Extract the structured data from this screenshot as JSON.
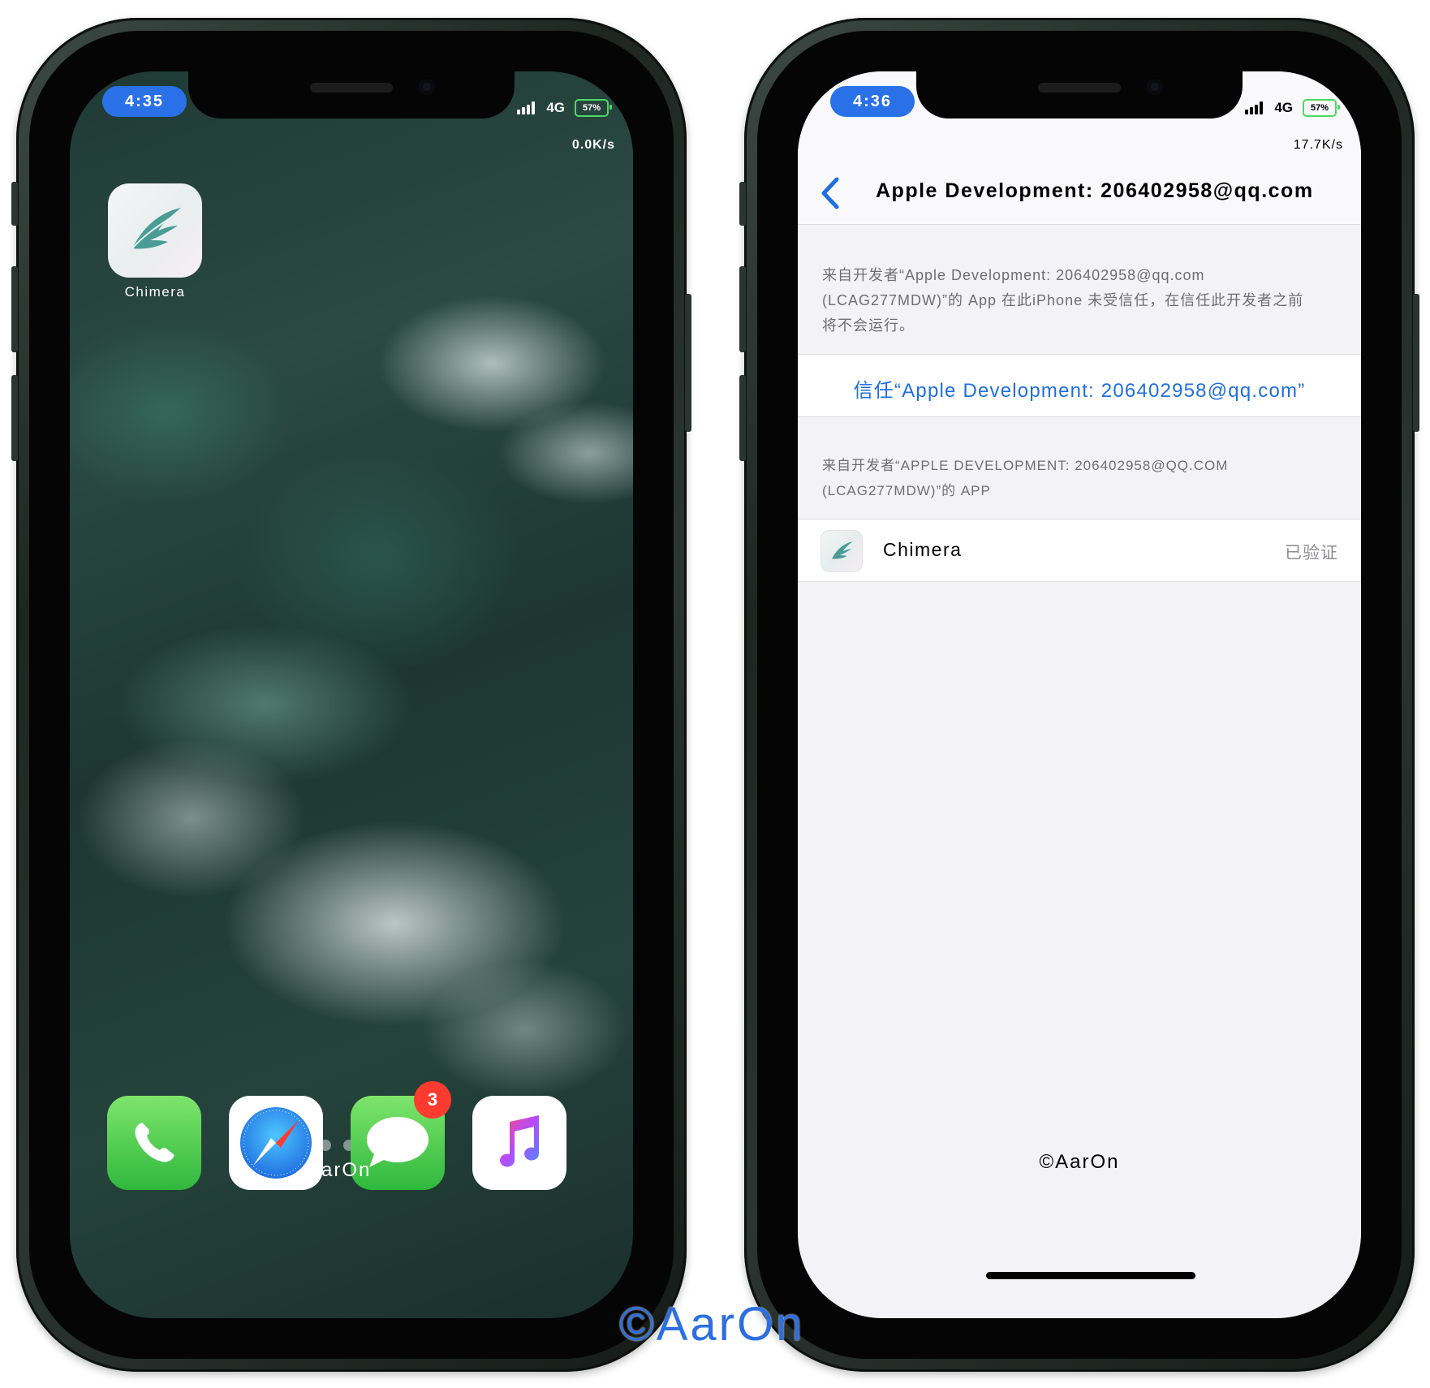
{
  "left_phone": {
    "time": "4:35",
    "network": "4G",
    "battery": "57%",
    "speed": "0.0K/s",
    "apps": [
      {
        "label": "Chimera",
        "icon": "chimera-feather-icon"
      }
    ],
    "dock": [
      {
        "icon": "phone-icon"
      },
      {
        "icon": "safari-icon"
      },
      {
        "icon": "messages-icon",
        "badge": "3"
      },
      {
        "icon": "music-icon"
      }
    ],
    "page_dots": {
      "count": 6,
      "active": 6
    },
    "watermark": "AarOn"
  },
  "right_phone": {
    "time": "4:36",
    "network": "4G",
    "battery": "57%",
    "speed": "17.7K/s",
    "nav_title": "Apple Development: 206402958@qq.com",
    "description": "来自开发者“Apple Development: 206402958@qq.com (LCAG277MDW)”的 App 在此iPhone 未受信任，在信任此开发者之前将不会运行。",
    "trust_button": "信任“Apple Development: 206402958@qq.com”",
    "section_header": "来自开发者“APPLE DEVELOPMENT: 206402958@QQ.COM (LCAG277MDW)”的 APP",
    "app_row": {
      "name": "Chimera",
      "status": "已验证"
    },
    "footer": "©AarOn"
  },
  "watermark": "©AarOn",
  "colors": {
    "accent": "#2a71e8",
    "link": "#1f6fe0",
    "badge": "#ff3b30",
    "battery": "#4cd964"
  }
}
